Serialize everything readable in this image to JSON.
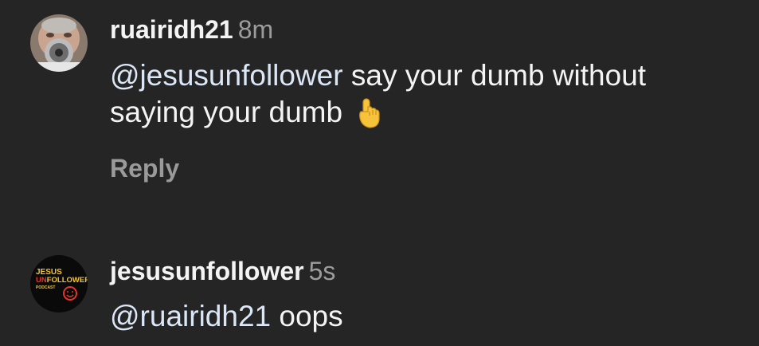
{
  "comments": [
    {
      "username": "ruairidh21",
      "time": "8m",
      "mention": "@jesusunfollower",
      "text_line1": " say your dumb without",
      "text_line2": "saying your dumb",
      "emoji": "pointing-up-hand-icon",
      "reply_label": "Reply"
    },
    {
      "username": "jesusunfollower",
      "time": "5s",
      "mention": "@ruairidh21",
      "text": " oops",
      "avatar_logo": {
        "line1": "JESUS",
        "line2a": "UN",
        "line2b": "FOLLOWER",
        "line3": "PODCAST"
      }
    }
  ],
  "colors": {
    "background": "#252525",
    "text": "#f4f4f4",
    "mention": "#dbe7f7",
    "secondary": "#9c9c9c",
    "logo_yellow": "#f3c53b",
    "logo_red": "#e5352b"
  }
}
